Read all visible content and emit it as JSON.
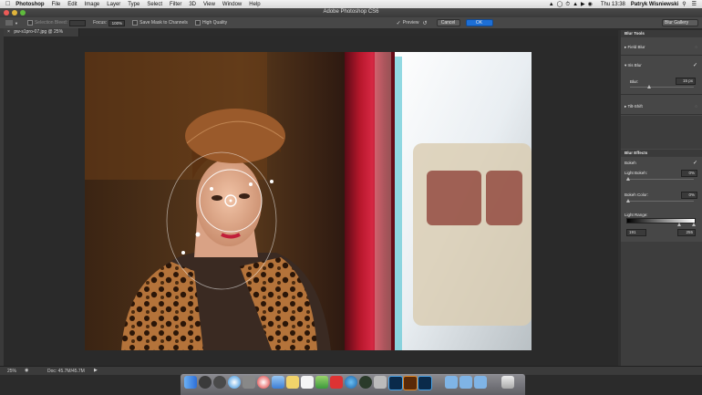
{
  "menubar": {
    "apple": "",
    "items": [
      "Photoshop",
      "File",
      "Edit",
      "Image",
      "Layer",
      "Type",
      "Select",
      "Filter",
      "3D",
      "View",
      "Window",
      "Help"
    ],
    "clock": "Thu 13:38",
    "user": "Patryk Wisniewski"
  },
  "window": {
    "title": "Adobe Photoshop CS6"
  },
  "options": {
    "selection_bleed_label": "Selection Bleed:",
    "focus_label": "Focus:",
    "focus_value": "100%",
    "save_mask_label": "Save Mask to Channels",
    "high_quality_label": "High Quality",
    "preview_label": "Preview",
    "cancel_label": "Cancel",
    "ok_label": "OK",
    "workspace": "Blur Gallery"
  },
  "document": {
    "tab": "pw-s1pro-07.jpg @ 25% (RGB/8)",
    "zoom": "25%",
    "doc_info": "Doc: 45.7M/45.7M"
  },
  "panels": {
    "blur_tools": {
      "title": "Blur Tools",
      "field_blur": "Field Blur",
      "iris_blur": "Iris Blur",
      "blur_label": "Blur:",
      "blur_value": "15 px",
      "blur_level": 0.3,
      "tilt_shift": "Tilt-Shift"
    },
    "blur_effects": {
      "title": "Blur Effects",
      "bokeh": "Bokeh",
      "light_bokeh_label": "Light Bokeh:",
      "light_bokeh_value": "0%",
      "bokeh_color_label": "Bokeh Color:",
      "bokeh_color_value": "0%",
      "light_range_label": "Light Range:",
      "light_range_low": "191",
      "light_range_high": "255"
    }
  },
  "colors": {
    "accent": "#1d6fd6",
    "panel": "#474747",
    "canvas": "#2a2a2a"
  },
  "dock_icons": [
    "finder-icon",
    "launchpad-icon",
    "mission-control-icon",
    "safari-icon",
    "system-preferences-icon",
    "itunes-icon",
    "mail-icon",
    "notes-icon",
    "calendar-icon",
    "photos-icon",
    "app-store-icon",
    "preview-icon",
    "photoshop-icon",
    "bridge-icon",
    "photoshop2-icon",
    "folder-icon",
    "folder2-icon",
    "downloads-icon",
    "trash-icon"
  ]
}
